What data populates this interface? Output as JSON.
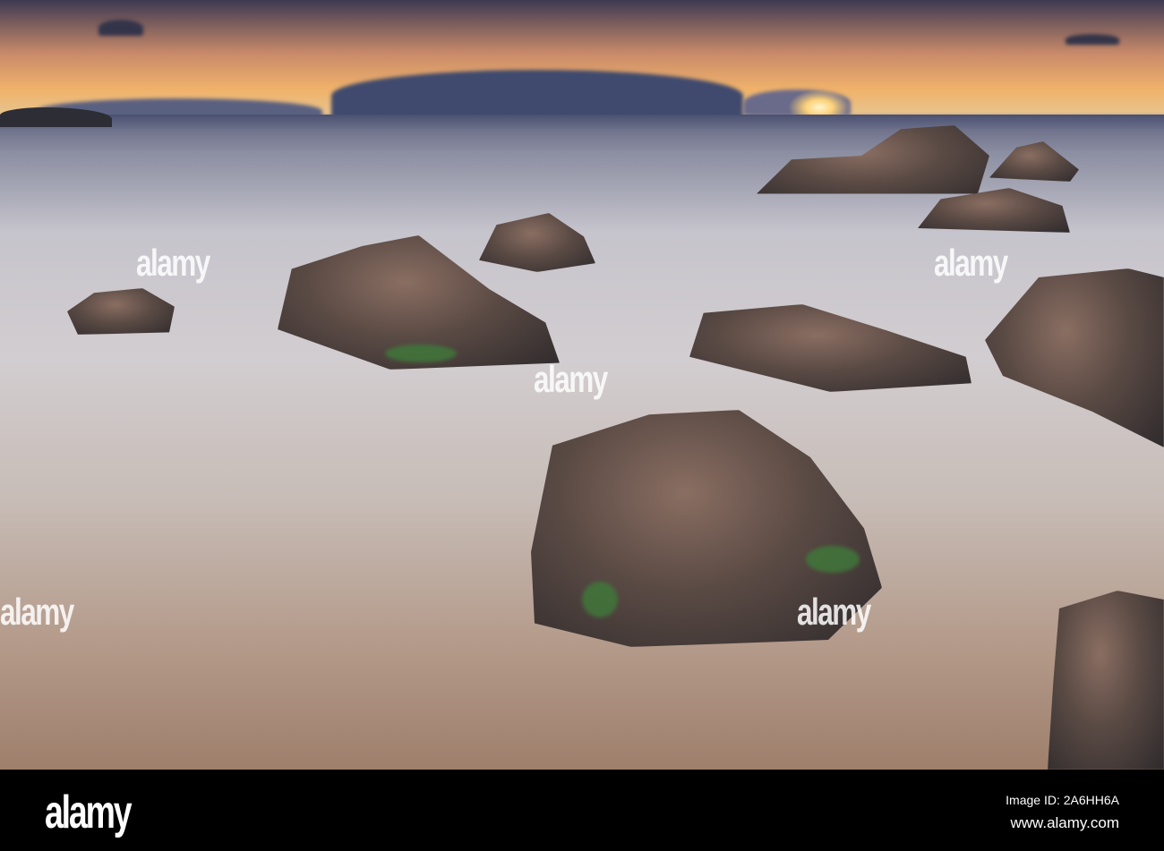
{
  "photo": {
    "subject": "long exposure sea with rocks at sunset",
    "watermark": "alamy"
  },
  "footer": {
    "logo": "alamy",
    "image_id": "Image ID: 2A6HH6A",
    "website": "www.alamy.com"
  }
}
